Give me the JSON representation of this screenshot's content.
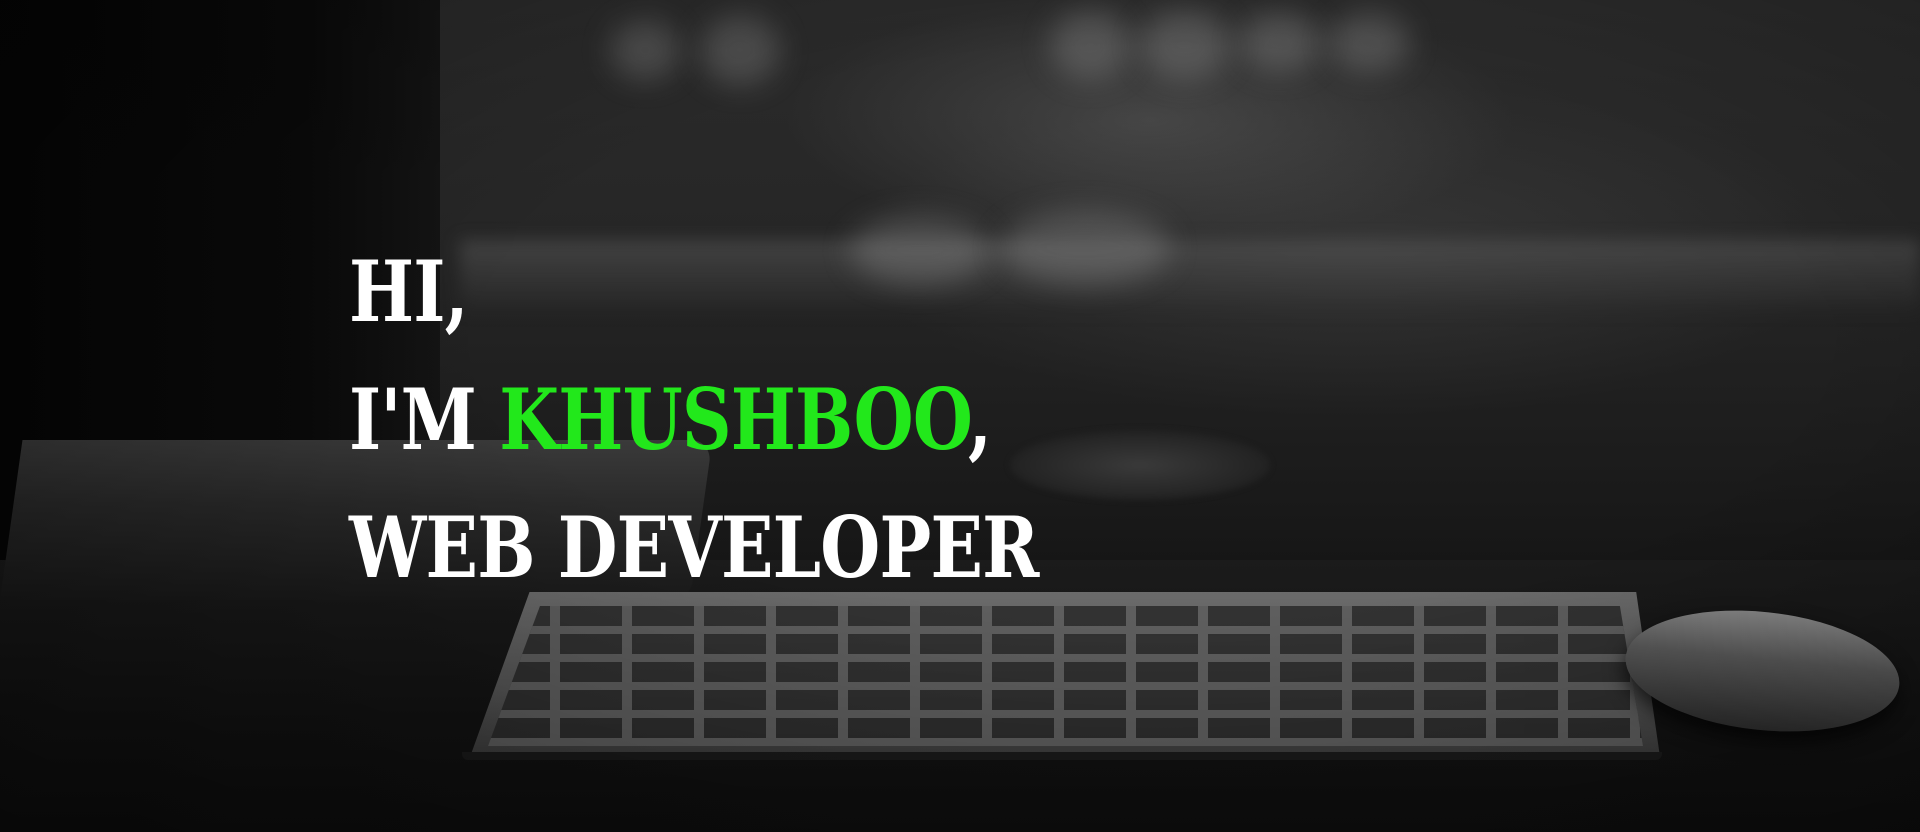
{
  "hero": {
    "greeting": "HI,",
    "intro_prefix": "I'M",
    "name": "KHUSHBOO",
    "name_suffix": ",",
    "role": "WEB DEVELOPER",
    "accent_color": "#22e81b",
    "text_color": "#ffffff"
  },
  "background": {
    "scene": "desk-with-keyboard-and-mouse"
  }
}
